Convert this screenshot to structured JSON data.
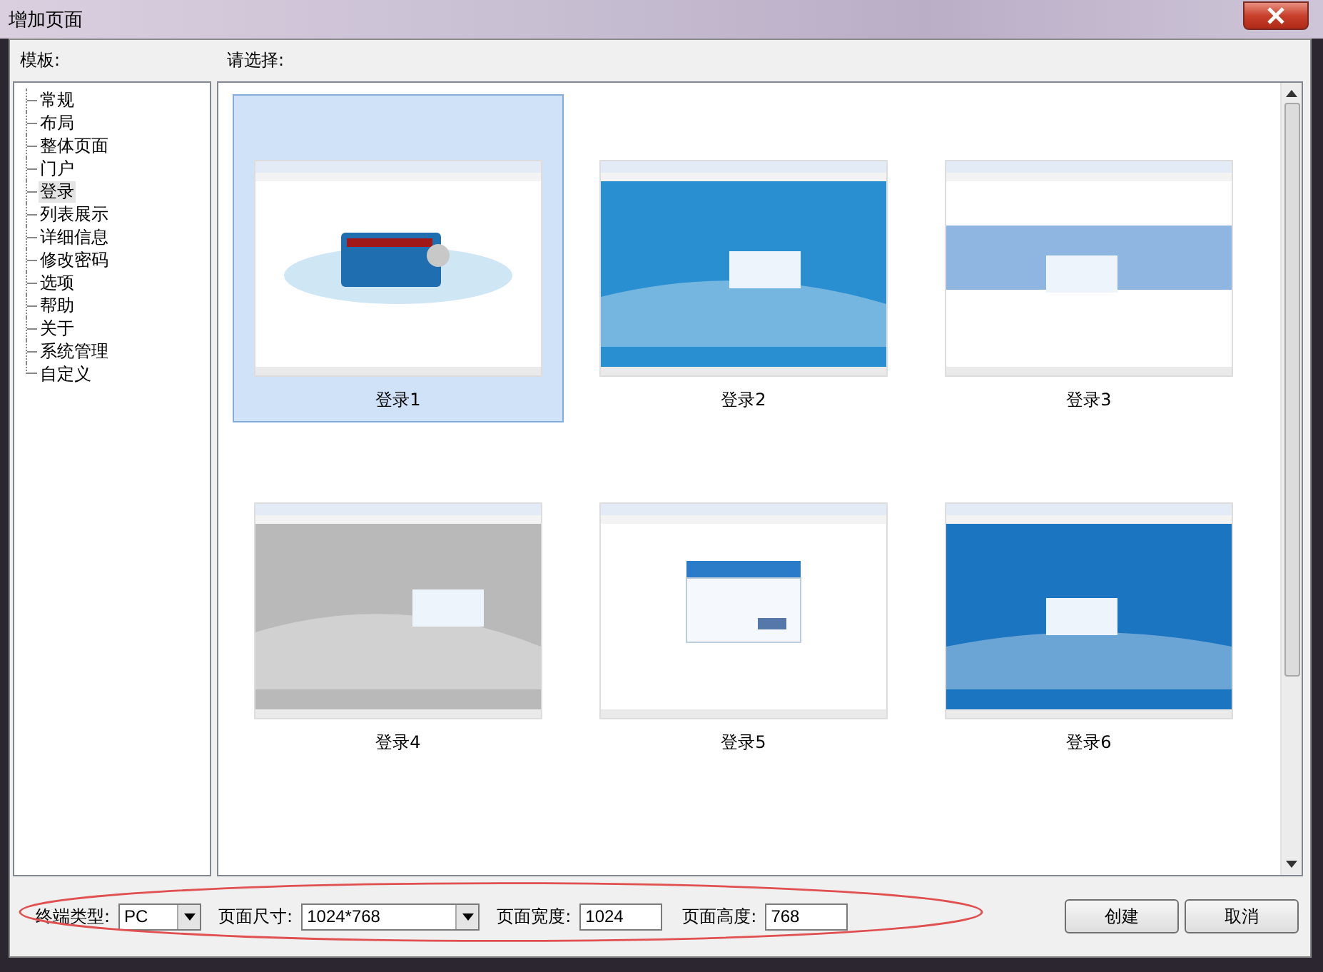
{
  "window": {
    "title": "增加页面"
  },
  "template_label": "模板:",
  "choose_label": "请选择:",
  "tree": [
    {
      "label": "常规",
      "selected": false
    },
    {
      "label": "布局",
      "selected": false
    },
    {
      "label": "整体页面",
      "selected": false
    },
    {
      "label": "门户",
      "selected": false
    },
    {
      "label": "登录",
      "selected": true
    },
    {
      "label": "列表展示",
      "selected": false
    },
    {
      "label": "详细信息",
      "selected": false
    },
    {
      "label": "修改密码",
      "selected": false
    },
    {
      "label": "选项",
      "selected": false
    },
    {
      "label": "帮助",
      "selected": false
    },
    {
      "label": "关于",
      "selected": false
    },
    {
      "label": "系统管理",
      "selected": false
    },
    {
      "label": "自定义",
      "selected": false
    }
  ],
  "templates": [
    {
      "label": "登录1",
      "selected": true
    },
    {
      "label": "登录2",
      "selected": false
    },
    {
      "label": "登录3",
      "selected": false
    },
    {
      "label": "登录4",
      "selected": false
    },
    {
      "label": "登录5",
      "selected": false
    },
    {
      "label": "登录6",
      "selected": false
    }
  ],
  "fields": [
    {
      "label": "终端类型:",
      "kind": "dropdown",
      "value": "PC"
    },
    {
      "label": "页面尺寸:",
      "kind": "dropdown",
      "value": "1024*768"
    },
    {
      "label": "页面宽度:",
      "kind": "text",
      "value": "1024"
    },
    {
      "label": "页面高度:",
      "kind": "text",
      "value": "768"
    }
  ],
  "buttons": [
    "创建",
    "取消"
  ]
}
